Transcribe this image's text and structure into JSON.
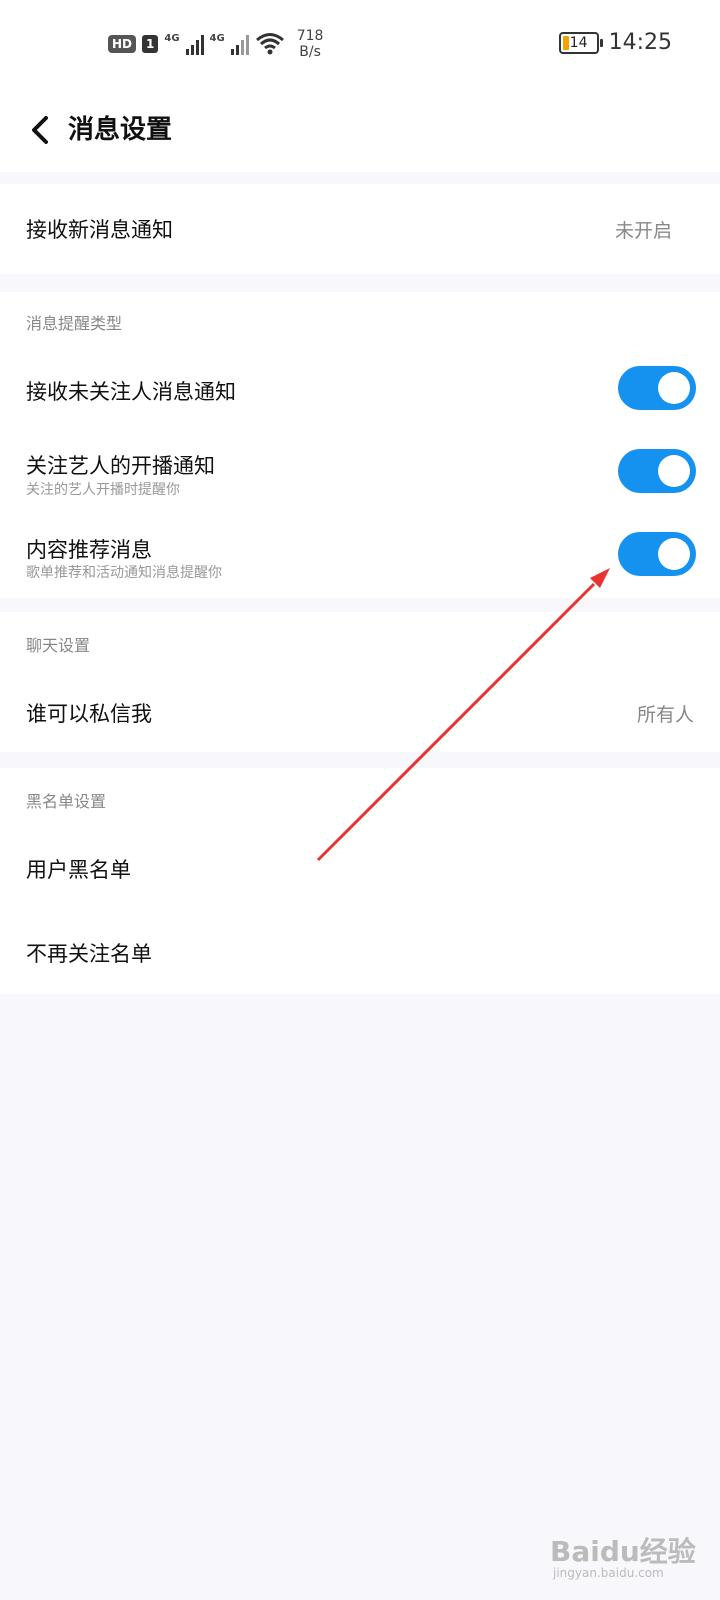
{
  "status_bar": {
    "hd": "HD",
    "sim": "1",
    "net1": "4G",
    "net2": "4G",
    "speed_value": "718",
    "speed_unit": "B/s",
    "battery": "14",
    "time": "14:25"
  },
  "header": {
    "title": "消息设置"
  },
  "section_receive": {
    "label": "接收新消息通知",
    "value": "未开启"
  },
  "section_reminder": {
    "title": "消息提醒类型",
    "items": [
      {
        "label": "接收未关注人消息通知",
        "sub": "",
        "on": true
      },
      {
        "label": "关注艺人的开播通知",
        "sub": "关注的艺人开播时提醒你",
        "on": true
      },
      {
        "label": "内容推荐消息",
        "sub": "歌单推荐和活动通知消息提醒你",
        "on": true
      }
    ]
  },
  "section_chat": {
    "title": "聊天设置",
    "label": "谁可以私信我",
    "value": "所有人"
  },
  "section_blacklist": {
    "title": "黑名单设置",
    "items": [
      "用户黑名单",
      "不再关注名单"
    ]
  },
  "colors": {
    "accent": "#1592f0",
    "arrow": "#e8332e"
  },
  "watermark": {
    "text": "Baidu经验",
    "sub": "jingyan.baidu.com"
  }
}
